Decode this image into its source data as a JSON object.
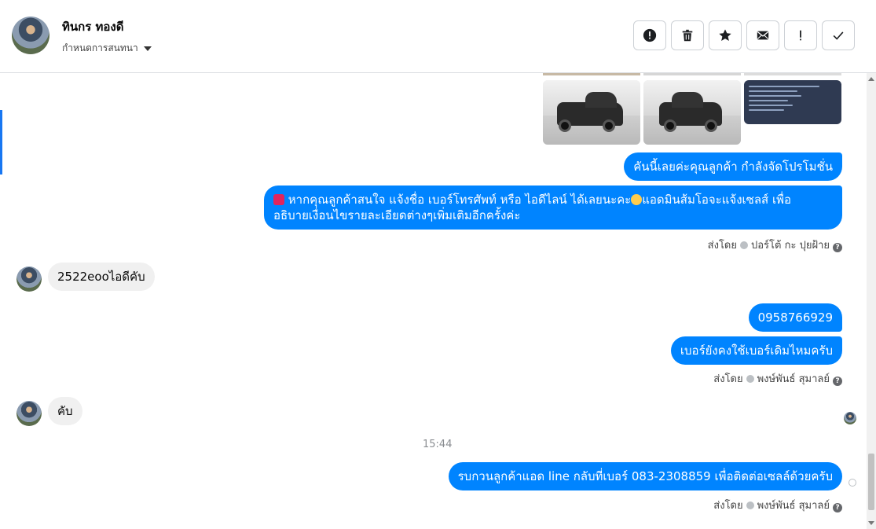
{
  "header": {
    "contact_name": "ทินกร ทองดี",
    "contact_sub": "กำหนดการสนทนา",
    "toolbar": [
      {
        "name": "mark-spam-button",
        "icon": "alert-circle-icon"
      },
      {
        "name": "delete-button",
        "icon": "trash-icon"
      },
      {
        "name": "star-button",
        "icon": "star-icon"
      },
      {
        "name": "mark-unread-button",
        "icon": "envelope-icon"
      },
      {
        "name": "important-button",
        "icon": "exclamation-icon"
      },
      {
        "name": "done-button",
        "icon": "check-icon"
      }
    ]
  },
  "messages": {
    "m1": "คันนี้เลยค่ะคุณลูกค้า กำลังจัดโปรโมชั่น",
    "m2_line1": "หากคุณลูกค้าสนใจ แจ้งชื่อ เบอร์โทรศัพท์ หรือ ไอดีไลน์  ได้เลยนะคะ",
    "m2_line1b": "แอดมินส้มโอจะแจ้งเซลส์   เพื่อ",
    "m2_line2": "อธิบายเงื่อนไขรายละเอียดต่างๆเพิ่มเติมอีกครั้งค่ะ",
    "sent_by_1": "ส่งโดย",
    "sender_1": "ปอร์โต้ กะ ปุยฝ้าย",
    "in1": "2522eooไอดีคับ",
    "m3": "0958766929",
    "m4": "เบอร์ยังคงใช้เบอร์เดิมไหมครับ",
    "sent_by_2": "ส่งโดย",
    "sender_2": "พงษ์พันธ์ สุมาลย์",
    "in2": "คับ",
    "time": "15:44",
    "m5": "รบกวนลูกค้าแอด line กลับที่เบอร์ 083-2308859 เพื่อติดต่อเซลล์ด้วยครับ",
    "sent_by_3": "ส่งโดย",
    "sender_3": "พงษ์พันธ์ สุมาลย์"
  },
  "colors": {
    "outgoing_bubble": "#0084ff",
    "incoming_bubble": "#f0f0f0",
    "accent": "#1877f2"
  }
}
